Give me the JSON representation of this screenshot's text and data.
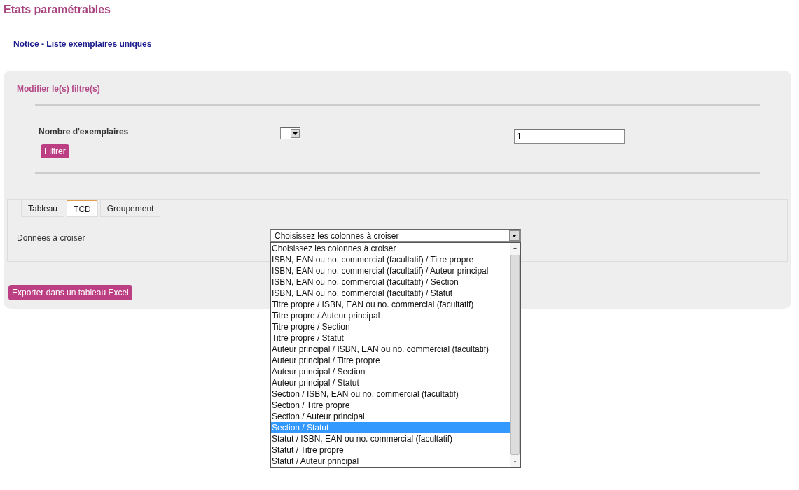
{
  "page_title": "Etats paramétrables",
  "report_link": "Notice - Liste exemplaires uniques",
  "filter_panel": {
    "heading": "Modifier le(s) filtre(s)",
    "filters": [
      {
        "label": "Nombre d'exemplaires",
        "operator": "=",
        "value": "1"
      }
    ],
    "filter_button": "Filtrer"
  },
  "tabs": [
    {
      "label": "Tableau",
      "selected": false
    },
    {
      "label": "TCD",
      "selected": true
    },
    {
      "label": "Groupement",
      "selected": false
    }
  ],
  "crosstab": {
    "label": "Données à croiser",
    "select_value": "Choisissez les colonnes à croiser",
    "options": [
      {
        "label": "Choisissez les colonnes à croiser",
        "selected": false
      },
      {
        "label": "ISBN, EAN ou no. commercial (facultatif) / Titre propre",
        "selected": false
      },
      {
        "label": "ISBN, EAN ou no. commercial (facultatif) / Auteur principal",
        "selected": false
      },
      {
        "label": "ISBN, EAN ou no. commercial (facultatif) / Section",
        "selected": false
      },
      {
        "label": "ISBN, EAN ou no. commercial (facultatif) / Statut",
        "selected": false
      },
      {
        "label": "Titre propre / ISBN, EAN ou no. commercial (facultatif)",
        "selected": false
      },
      {
        "label": "Titre propre / Auteur principal",
        "selected": false
      },
      {
        "label": "Titre propre / Section",
        "selected": false
      },
      {
        "label": "Titre propre / Statut",
        "selected": false
      },
      {
        "label": "Auteur principal / ISBN, EAN ou no. commercial (facultatif)",
        "selected": false
      },
      {
        "label": "Auteur principal / Titre propre",
        "selected": false
      },
      {
        "label": "Auteur principal / Section",
        "selected": false
      },
      {
        "label": "Auteur principal / Statut",
        "selected": false
      },
      {
        "label": "Section / ISBN, EAN ou no. commercial (facultatif)",
        "selected": false
      },
      {
        "label": "Section / Titre propre",
        "selected": false
      },
      {
        "label": "Section / Auteur principal",
        "selected": false
      },
      {
        "label": "Section / Statut",
        "selected": true
      },
      {
        "label": "Statut / ISBN, EAN ou no. commercial (facultatif)",
        "selected": false
      },
      {
        "label": "Statut / Titre propre",
        "selected": false
      },
      {
        "label": "Statut / Auteur principal",
        "selected": false
      }
    ]
  },
  "export_button": "Exporter dans un tableau Excel"
}
